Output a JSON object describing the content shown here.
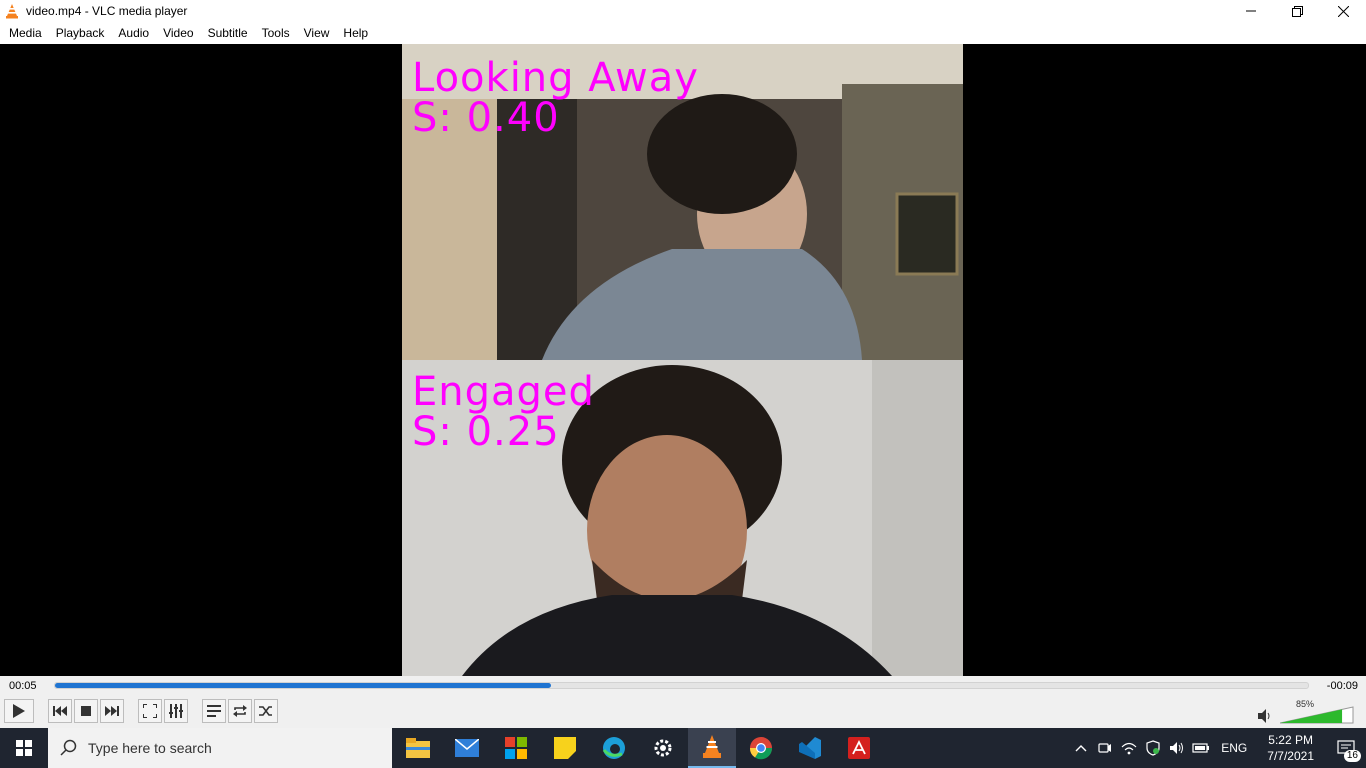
{
  "window": {
    "title": "video.mp4 - VLC media player",
    "minimize_icon": "minimize-icon",
    "maximize_icon": "restore-icon",
    "close_icon": "close-icon"
  },
  "menu": {
    "items": [
      "Media",
      "Playback",
      "Audio",
      "Video",
      "Subtitle",
      "Tools",
      "View",
      "Help"
    ]
  },
  "video": {
    "top_label": "Looking Away",
    "top_score": "S: 0.40",
    "bottom_label": "Engaged",
    "bottom_score": "S: 0.25",
    "overlay_color": "#ff00ff"
  },
  "playback": {
    "time_elapsed": "00:05",
    "time_remaining": "-00:09",
    "progress_fraction": 0.396,
    "seek_color": "#1f74d1"
  },
  "controls": {
    "volume_label": "85%",
    "volume_fraction": 0.85,
    "volume_color": "#2db92d"
  },
  "taskbar": {
    "search_placeholder": "Type here to search",
    "apps": [
      "file-explorer-icon",
      "mail-icon",
      "office-icon",
      "sticky-notes-icon",
      "edge-icon",
      "settings-icon",
      "vlc-icon",
      "chrome-icon",
      "vscode-icon",
      "acrobat-icon"
    ],
    "language": "ENG",
    "time": "5:22 PM",
    "date": "7/7/2021",
    "notification_count": "16"
  }
}
